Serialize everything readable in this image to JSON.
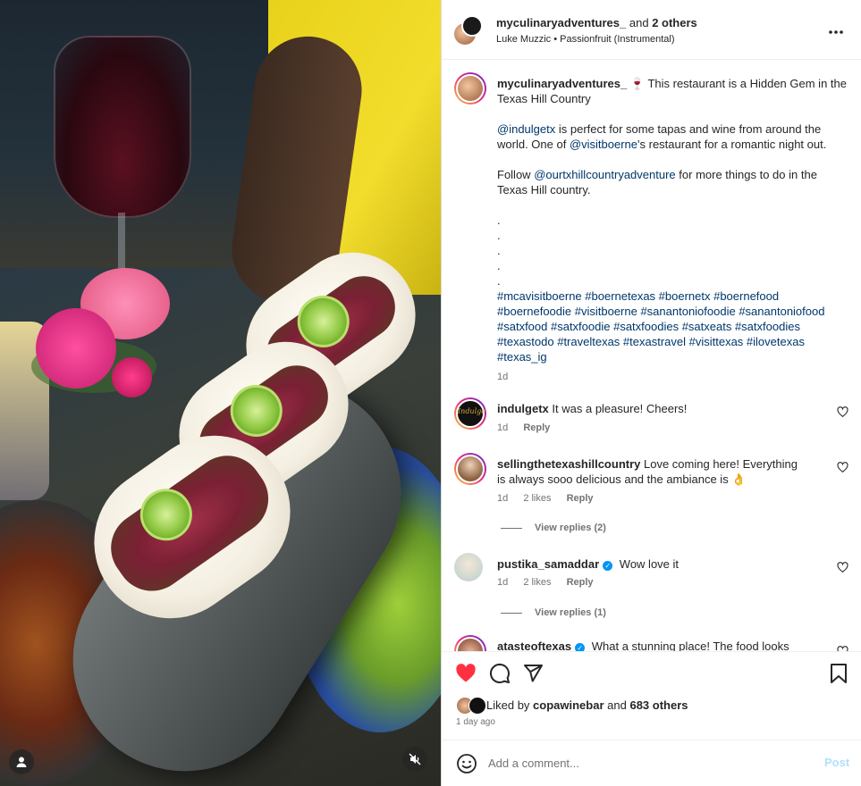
{
  "header": {
    "author": "myculinaryadventures_",
    "and": "and",
    "others": "2 others",
    "audio_artist": "Luke Muzzic",
    "audio_sep": "•",
    "audio_track": "Passionfruit (Instrumental)",
    "more_icon": "more-horizontal-icon"
  },
  "caption": {
    "username": "myculinaryadventures_",
    "emoji": "🍷",
    "line1": "This restaurant is a Hidden Gem in the Texas Hill Country",
    "mention1": "@indulgetx",
    "line2": "is perfect for some tapas and wine from around the world. One of",
    "mention2": "@visitboerne",
    "line2b": "'s restaurant for a romantic night out.",
    "line3a": "Follow",
    "mention3": "@ourtxhillcountryadventure",
    "line3b": "for more things to do in the Texas Hill country.",
    "dots": [
      ".",
      ".",
      ".",
      ".",
      "."
    ],
    "hashtags": "#mcavisitboerne #boernetexas #boernetx #boernefood #boernefoodie #visitboerne #sanantoniofoodie #sanantoniofood #satxfood #satxfoodie #satxfoodies #satxeats #satxfoodies #texastodo #traveltexas #texastravel #visittexas #ilovetexas #texas_ig",
    "time": "1d"
  },
  "comments": [
    {
      "username": "indulgetx",
      "text": "It was a pleasure! Cheers!",
      "time": "1d",
      "likes": "",
      "reply": "Reply"
    },
    {
      "username": "sellingthetexashillcountry",
      "text": "Love coming here! Everything is always sooo delicious and the ambiance is 👌",
      "time": "1d",
      "likes": "2 likes",
      "reply": "Reply",
      "view_replies": "View replies (2)"
    },
    {
      "username": "pustika_samaddar",
      "text": "Wow love it",
      "time": "1d",
      "likes": "2 likes",
      "reply": "Reply",
      "view_replies": "View replies (1)"
    },
    {
      "username": "atasteoftexas",
      "text": "What a stunning place! The food looks"
    }
  ],
  "actions": {
    "liked_prefix": "Liked by",
    "liked_user": "copawinebar",
    "liked_and": "and",
    "liked_count": "683 others",
    "time_ago": "1 day ago"
  },
  "add_comment": {
    "placeholder": "Add a comment...",
    "post": "Post"
  },
  "colors": {
    "like_red": "#ff3040",
    "link_blue": "#00376b",
    "post_disabled": "#b2dffc",
    "verified_blue": "#0095f6"
  }
}
